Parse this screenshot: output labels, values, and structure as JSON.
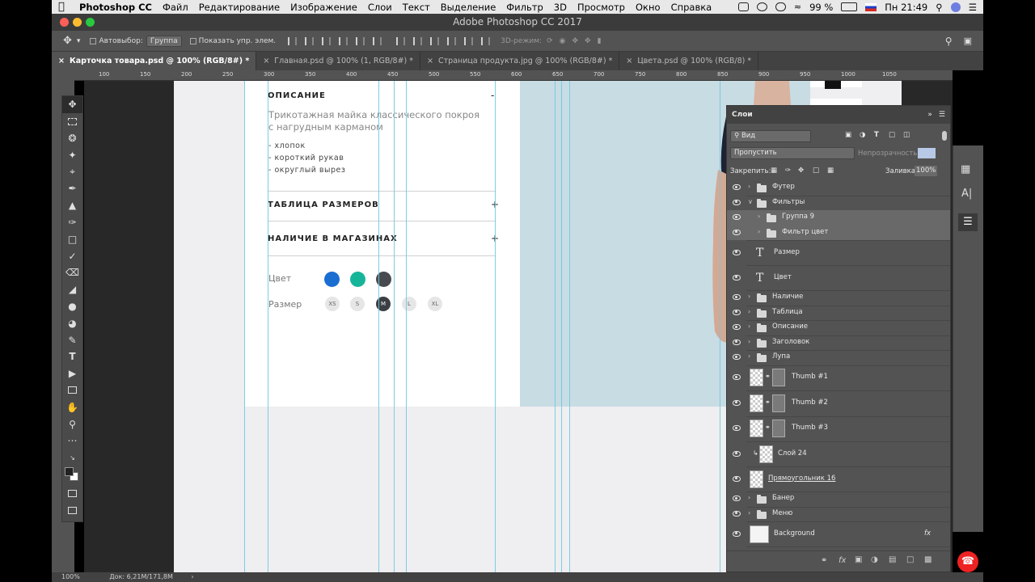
{
  "menubar": {
    "app": "Photoshop CC",
    "items": [
      "Файл",
      "Редактирование",
      "Изображение",
      "Слои",
      "Текст",
      "Выделение",
      "Фильтр",
      "3D",
      "Просмотр",
      "Окно",
      "Справка"
    ],
    "battery": "99 %",
    "clock": "Пн 21:49"
  },
  "window": {
    "title": "Adobe Photoshop CC 2017"
  },
  "options": {
    "autoselect_label": "Автовыбор:",
    "autoselect_value": "Группа",
    "show_controls": "Показать упр. элем.",
    "mode3d": "3D-режим:"
  },
  "tabs": [
    "Карточка товара.psd @ 100% (RGB/8#) *",
    "Главная.psd @ 100% (1, RGB/8#) *",
    "Страница продукта.jpg @ 100% (RGB/8#) *",
    "Цвета.psd @ 100% (RGB/8) *"
  ],
  "ruler": [
    "100",
    "150",
    "200",
    "250",
    "300",
    "350",
    "400",
    "450",
    "500",
    "550",
    "600",
    "650",
    "700",
    "750",
    "800",
    "850",
    "900",
    "950",
    "1000",
    "1050"
  ],
  "doc": {
    "section1": {
      "title": "ОПИСАНИЕ",
      "sign": "-"
    },
    "description": "Трикотажная майка классического покроя с нагрудным карманом",
    "features": [
      "- хлопок",
      "- короткий рукав",
      "- округлый вырез"
    ],
    "section2": {
      "title": "ТАБЛИЦА РАЗМЕРОВ",
      "sign": "+"
    },
    "section3": {
      "title": "НАЛИЧИЕ В МАГАЗИНАХ",
      "sign": "+"
    },
    "color_label": "Цвет",
    "size_label": "Размер",
    "colors": [
      "#1b6ed1",
      "#16b59a",
      "#474b50"
    ],
    "sizes": [
      "XS",
      "S",
      "M",
      "L",
      "XL"
    ],
    "selected_size": "M"
  },
  "layers_panel": {
    "title": "Слои",
    "filter_label": "Вид",
    "blend": "Пропустить",
    "opacity_label": "Непрозрачность:",
    "lock_label": "Закрепить:",
    "fill_label": "Заливка:",
    "fill_value": "100%",
    "layers": [
      {
        "name": "Футер",
        "type": "folder",
        "indent": 0,
        "expanded": false
      },
      {
        "name": "Фильтры",
        "type": "folder",
        "indent": 0,
        "expanded": true
      },
      {
        "name": "Группа 9",
        "type": "folder",
        "indent": 1,
        "expanded": false,
        "selected": true
      },
      {
        "name": "Фильтр цвет",
        "type": "folder",
        "indent": 1,
        "expanded": false,
        "selected": true
      },
      {
        "name": "Размер",
        "type": "text"
      },
      {
        "name": "Цвет",
        "type": "text"
      },
      {
        "name": "Наличие",
        "type": "folder",
        "indent": 0
      },
      {
        "name": "Таблица",
        "type": "folder",
        "indent": 0
      },
      {
        "name": "Описание",
        "type": "folder",
        "indent": 0
      },
      {
        "name": "Заголовок",
        "type": "folder",
        "indent": 0
      },
      {
        "name": "Лупа",
        "type": "folder",
        "indent": 0
      },
      {
        "name": "Thumb #1",
        "type": "smart"
      },
      {
        "name": "Thumb #2",
        "type": "smart"
      },
      {
        "name": "Thumb #3",
        "type": "smart"
      },
      {
        "name": "Слой 24",
        "type": "pixel"
      },
      {
        "name": "Прямоугольник 16",
        "type": "shape"
      },
      {
        "name": "Банер",
        "type": "folder",
        "indent": 0
      },
      {
        "name": "Меню",
        "type": "folder",
        "indent": 0
      },
      {
        "name": "Background",
        "type": "background"
      }
    ]
  },
  "status": {
    "zoom": "100%",
    "doc": "Док: 6,21M/171,8M"
  }
}
